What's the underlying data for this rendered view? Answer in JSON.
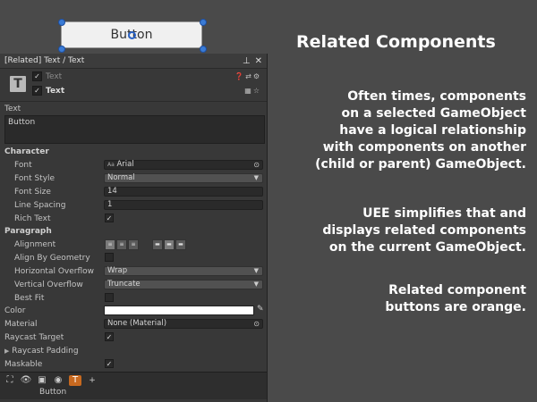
{
  "scene": {
    "button_text": "Button"
  },
  "inspector": {
    "title": "[Related] Text / Text",
    "header": {
      "row1": "Text",
      "row2": "Text"
    },
    "text_section": {
      "label": "Text",
      "value": "Button"
    },
    "character": {
      "heading": "Character",
      "font_label": "Font",
      "font_value": "Arial",
      "font_style_label": "Font Style",
      "font_style_value": "Normal",
      "font_size_label": "Font Size",
      "font_size_value": "14",
      "line_spacing_label": "Line Spacing",
      "line_spacing_value": "1",
      "rich_text_label": "Rich Text"
    },
    "paragraph": {
      "heading": "Paragraph",
      "alignment_label": "Alignment",
      "align_by_geometry_label": "Align By Geometry",
      "h_overflow_label": "Horizontal Overflow",
      "h_overflow_value": "Wrap",
      "v_overflow_label": "Vertical Overflow",
      "v_overflow_value": "Truncate",
      "best_fit_label": "Best Fit"
    },
    "color_label": "Color",
    "material_label": "Material",
    "material_value": "None (Material)",
    "raycast_target_label": "Raycast Target",
    "raycast_padding_label": "Raycast Padding",
    "maskable_label": "Maskable",
    "footer_label": "Button",
    "icons": {
      "related_highlight_color": "#c8691f"
    }
  },
  "panel": {
    "title": "Related Components",
    "para1": [
      "Often times, components",
      "on a selected GameObject",
      "have a logical relationship",
      "with components on another",
      "(child or parent) GameObject."
    ],
    "para2": [
      "UEE simplifies that and",
      "displays related components",
      "on the current GameObject."
    ],
    "para3": [
      "Related component",
      "buttons are orange."
    ]
  }
}
